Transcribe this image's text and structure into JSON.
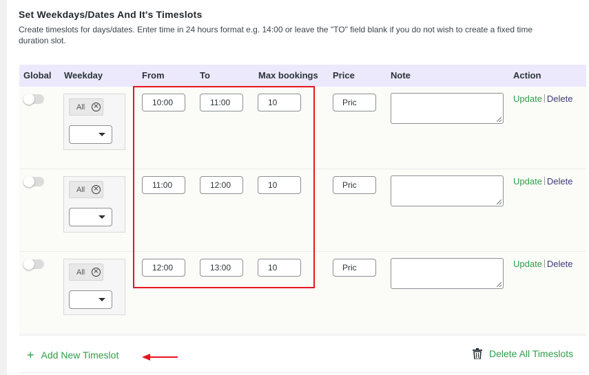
{
  "section": {
    "title": "Set Weekdays/Dates And It's Timeslots",
    "description": "Create timeslots for days/dates. Enter time in 24 hours format e.g. 14:00 or leave the \"TO\" field blank if you do not wish to create a fixed time duration slot."
  },
  "table": {
    "headers": {
      "global": "Global",
      "weekday": "Weekday",
      "from": "From",
      "to": "To",
      "max": "Max bookings",
      "price": "Price",
      "note": "Note",
      "action": "Action"
    },
    "rows": [
      {
        "global": false,
        "weekday_tag": "All",
        "from": "10:00",
        "to": "11:00",
        "max": "10",
        "price_placeholder": "Pric",
        "note": "",
        "update": "Update",
        "delete": "Delete"
      },
      {
        "global": false,
        "weekday_tag": "All",
        "from": "11:00",
        "to": "12:00",
        "max": "10",
        "price_placeholder": "Pric",
        "note": "",
        "update": "Update",
        "delete": "Delete"
      },
      {
        "global": false,
        "weekday_tag": "All",
        "from": "12:00",
        "to": "13:00",
        "max": "10",
        "price_placeholder": "Pric",
        "note": "",
        "update": "Update",
        "delete": "Delete"
      }
    ]
  },
  "footer": {
    "add_label": "Add New Timeslot",
    "add_icon": "+",
    "delete_all_label": "Delete All Timeslots"
  },
  "colors": {
    "accent_green": "#2e9e48",
    "header_bg": "#ebe9fb",
    "highlight_red": "#e8141d",
    "delete_link": "#3c3a7a"
  }
}
